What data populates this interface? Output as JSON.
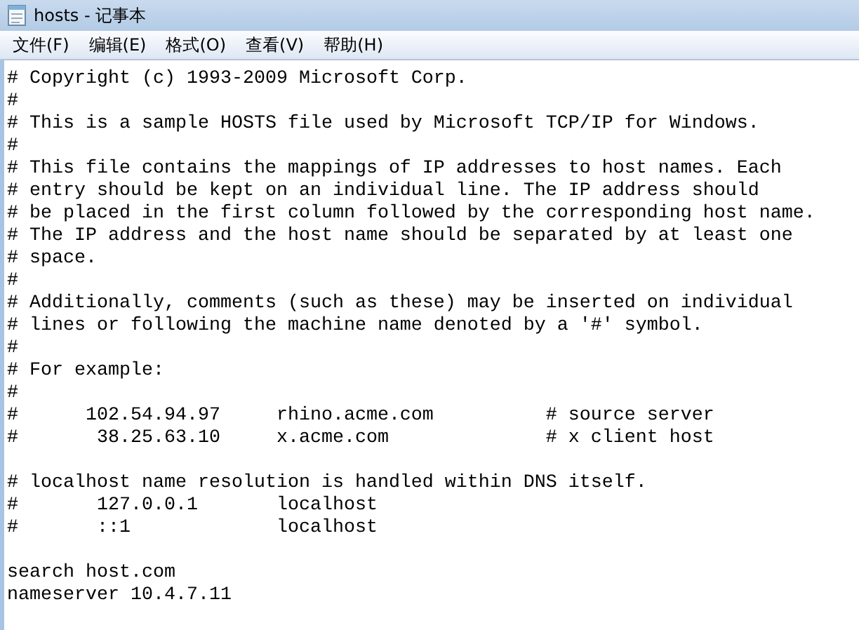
{
  "window": {
    "title": "hosts - 记事本"
  },
  "menu": [
    "文件(F)",
    "编辑(E)",
    "格式(O)",
    "查看(V)",
    "帮助(H)"
  ],
  "editor": {
    "blocks": [
      {
        "lines": [
          "# Copyright (c) 1993-2009 Microsoft Corp.",
          "#",
          "# This is a sample HOSTS file used by Microsoft TCP/IP for Windows.",
          "#",
          "# This file contains the mappings of IP addresses to host names. Each",
          "# entry should be kept on an individual line. The IP address should",
          "# be placed in the first column followed by the corresponding host name.",
          "# The IP address and the host name should be separated by at least one",
          "# space.",
          "#",
          "# Additionally, comments (such as these) may be inserted on individual",
          "# lines or following the machine name denoted by a '#' symbol.",
          "#",
          "# For example:",
          "#",
          "#      102.54.94.97     rhino.acme.com          # source server",
          "#       38.25.63.10     x.acme.com              # x client host"
        ]
      },
      {
        "lines": [
          "# localhost name resolution is handled within DNS itself.",
          "#       127.0.0.1       localhost",
          "#       ::1             localhost"
        ]
      },
      {
        "lines": [
          "search host.com",
          "nameserver 10.4.7.11"
        ]
      }
    ]
  }
}
